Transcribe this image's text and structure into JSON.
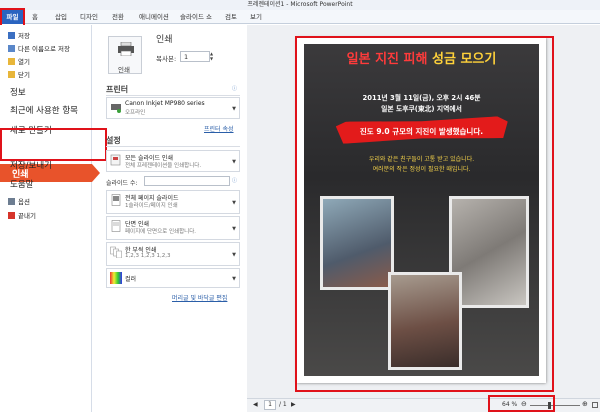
{
  "window": {
    "title": "프레젠테이션1 - Microsoft PowerPoint"
  },
  "ribbon_tabs": [
    "파일",
    "홈",
    "삽입",
    "디자인",
    "전환",
    "애니메이션",
    "슬라이드 쇼",
    "검토",
    "보기"
  ],
  "nav": {
    "small_items": [
      "저장",
      "다른 이름으로 저장",
      "열기",
      "닫기"
    ],
    "info": "정보",
    "recent": "최근에 사용한 항목",
    "new": "새로 만들기",
    "print": "인쇄",
    "save_send": "저장/보내기",
    "help": "도움말",
    "options": "옵션",
    "exit": "끝내기"
  },
  "print": {
    "header": "인쇄",
    "button_label": "인쇄",
    "copies_label": "복사본:",
    "copies_value": "1",
    "printer_header": "프린터",
    "printer_name": "Canon Inkjet MP980 series",
    "printer_status": "오프라인",
    "printer_properties": "프린터 속성",
    "settings_header": "설정",
    "slides_label": "슬라이드 수:",
    "slides_value": "",
    "footer_link": "머리글 및 바닥글 편집",
    "options": [
      {
        "line1": "모든 슬라이드 인쇄",
        "line2": "전체 프레젠테이션을 인쇄합니다."
      },
      {
        "line1": "전체 페이지 슬라이드",
        "line2": "1슬라이드/페이지 인쇄"
      },
      {
        "line1": "단면 인쇄",
        "line2": "페이지에 단면으로 인쇄합니다."
      },
      {
        "line1": "한 부씩 인쇄",
        "line2": "1,2,3     1,2,3     1,2,3"
      },
      {
        "line1": "컬러",
        "line2": ""
      }
    ]
  },
  "slide": {
    "title_part1": "일본 지진 피해",
    "title_part2": "성금 모으기",
    "date_line": "2011년 3월 11일(금), 오후 2시 46분",
    "place_line": "일본 도후쿠(東北) 지역에서",
    "banner": "진도 9.0 규모의 지진이 발생했습니다.",
    "message_line1": "우리와 같은 친구들이 고통 받고 있습니다.",
    "message_line2": "여러분의 작은 정성이 필요한 때입니다."
  },
  "status": {
    "page_current": "1",
    "page_total": "/ 1",
    "zoom": "64 %",
    "zoom_level": 0.64
  },
  "colors": {
    "accent": "#e8532b",
    "ribbon_file": "#2a64c0",
    "highlight": "#e0121a",
    "banner": "#e31b1b",
    "slide_title": "#ff3b3b"
  }
}
